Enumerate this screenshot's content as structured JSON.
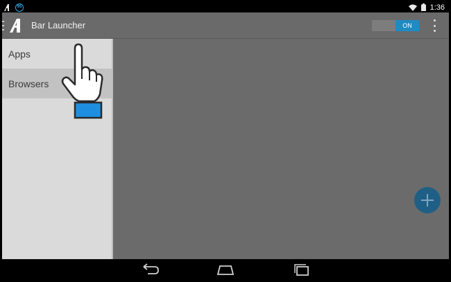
{
  "status_bar": {
    "notification_badge": "95",
    "time": "1:36"
  },
  "action_bar": {
    "title": "Bar Launcher",
    "toggle_label": "ON"
  },
  "drawer": {
    "items": [
      {
        "label": "Apps"
      },
      {
        "label": "Browsers"
      }
    ]
  },
  "colors": {
    "accent": "#1e8bc3",
    "fab": "#1f5f86",
    "drawer_bg": "#dadada",
    "content_bg": "#6b6b6b"
  },
  "icons": {
    "drawer": "drawer-toggle-icon",
    "logo": "bar-launcher-logo",
    "overflow": "overflow-menu-icon",
    "fab": "add-icon",
    "pointer": "hand-pointer-icon",
    "nav_back": "back-icon",
    "nav_home": "home-icon",
    "nav_recent": "recent-apps-icon"
  }
}
